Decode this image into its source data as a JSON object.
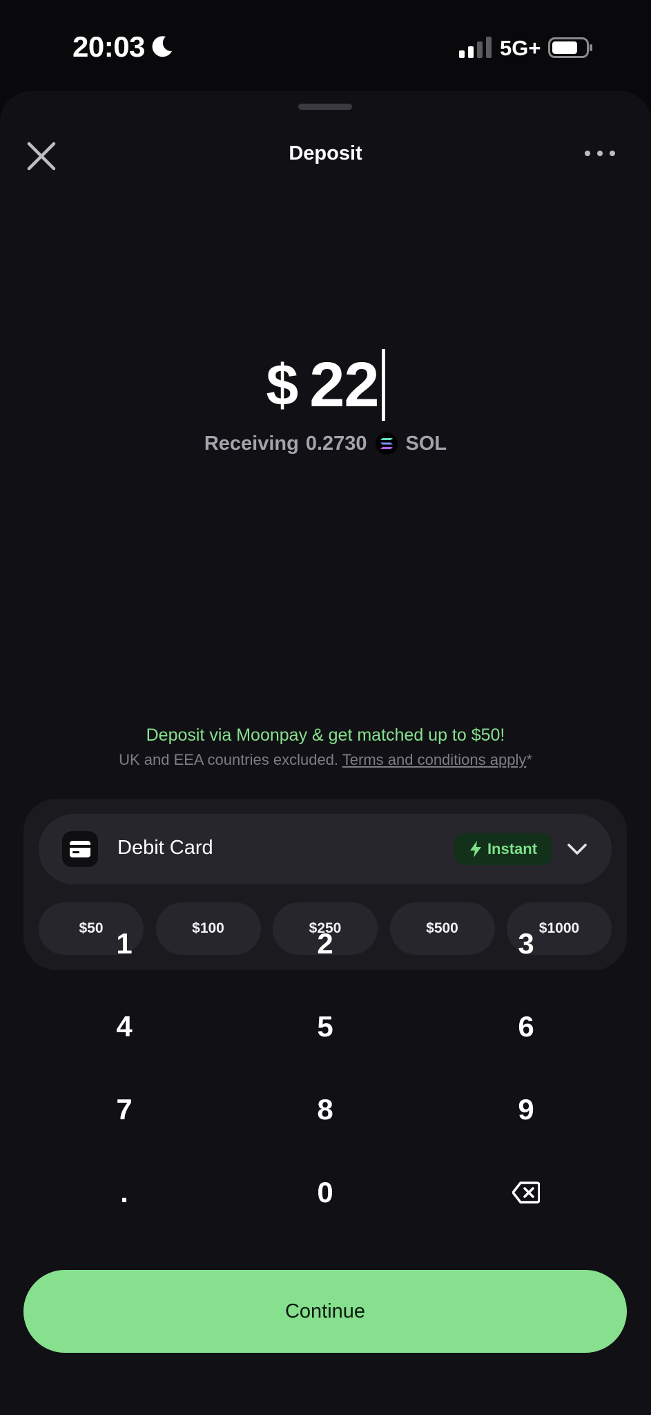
{
  "status_bar": {
    "time": "20:03",
    "network": "5G+"
  },
  "header": {
    "title": "Deposit"
  },
  "amount": {
    "currency_symbol": "$",
    "value": "22"
  },
  "receiving": {
    "label": "Receiving",
    "amount": "0.2730",
    "token": "SOL"
  },
  "promo": {
    "headline": "Deposit via Moonpay & get matched up to $50!",
    "note": "UK and EEA countries excluded.",
    "terms_link": "Terms and conditions apply",
    "asterisk": "*"
  },
  "payment_method": {
    "label": "Debit Card",
    "badge": "Instant"
  },
  "quick_amounts": [
    "$50",
    "$100",
    "$250",
    "$500",
    "$1000"
  ],
  "keypad": {
    "keys": [
      "1",
      "2",
      "3",
      "4",
      "5",
      "6",
      "7",
      "8",
      "9",
      ".",
      "0"
    ]
  },
  "continue_label": "Continue",
  "colors": {
    "accent": "#86e08e",
    "background": "#111115",
    "badge_bg": "#12301a"
  }
}
